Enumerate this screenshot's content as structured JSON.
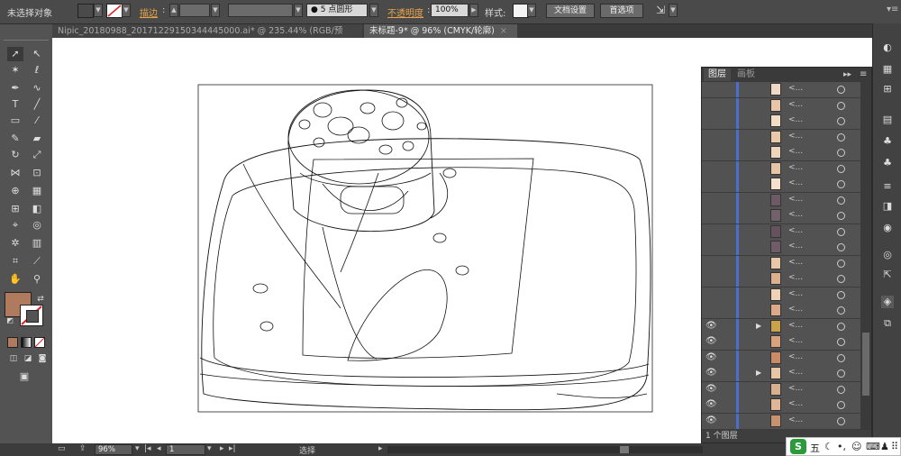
{
  "control_bar": {
    "selection_label": "未选择对象",
    "stroke_label": "描边",
    "brush_label": "5 点圆形",
    "opacity_label": "不透明度",
    "opacity_value": "100%",
    "style_label": "样式",
    "doc_settings_button": "文档设置",
    "preferences_button": "首选项",
    "fill_color": "#b07a5e"
  },
  "document_tabs": [
    {
      "title": "Nipic_20180988_20171229150344445000.ai* @ 235.44% (RGB/预览)",
      "active": false
    },
    {
      "title": "未标题-9* @ 96% (CMYK/轮廓)",
      "active": true
    }
  ],
  "tab_close_glyph": "×",
  "toolbox": {
    "fill_color": "#b07a5e"
  },
  "layers_panel": {
    "tabs": [
      "图层",
      "画板"
    ],
    "menu_glyph": "≡",
    "layer_name_placeholder": "<...",
    "rows": [
      {
        "visible": false,
        "expand": false,
        "thumb": "#f0d8c4"
      },
      {
        "visible": false,
        "expand": false,
        "thumb": "#e8c4a8"
      },
      {
        "visible": false,
        "expand": false,
        "thumb": "#f2dcc6"
      },
      {
        "visible": false,
        "expand": false,
        "thumb": "#eac8aa"
      },
      {
        "visible": false,
        "expand": false,
        "thumb": "#f0d4bc"
      },
      {
        "visible": false,
        "expand": false,
        "thumb": "#e6c4a6"
      },
      {
        "visible": false,
        "expand": false,
        "thumb": "#f4e0cc"
      },
      {
        "visible": false,
        "expand": false,
        "thumb": "#6e5a66"
      },
      {
        "visible": false,
        "expand": false,
        "thumb": "#72606a"
      },
      {
        "visible": false,
        "expand": false,
        "thumb": "#66525e"
      },
      {
        "visible": false,
        "expand": false,
        "thumb": "#705c68"
      },
      {
        "visible": false,
        "expand": false,
        "thumb": "#e9c7a9"
      },
      {
        "visible": false,
        "expand": false,
        "thumb": "#dab08e"
      },
      {
        "visible": false,
        "expand": false,
        "thumb": "#efd2b8"
      },
      {
        "visible": false,
        "expand": false,
        "thumb": "#d9a988"
      },
      {
        "visible": true,
        "expand": true,
        "thumb": "#c9a24a"
      },
      {
        "visible": true,
        "expand": false,
        "thumb": "#d9a27e"
      },
      {
        "visible": true,
        "expand": false,
        "thumb": "#c98c66"
      },
      {
        "visible": true,
        "expand": true,
        "thumb": "#e8c6a6"
      },
      {
        "visible": true,
        "expand": false,
        "thumb": "#d8b08e"
      },
      {
        "visible": true,
        "expand": false,
        "thumb": "#e0b696"
      },
      {
        "visible": true,
        "expand": false,
        "thumb": "#c89270"
      }
    ],
    "footer_label": "1 个图层"
  },
  "status_bar": {
    "zoom": "96%",
    "page": "1",
    "tool_label": "选择"
  },
  "ime_bar": {
    "logo": "S",
    "mode": "五"
  }
}
